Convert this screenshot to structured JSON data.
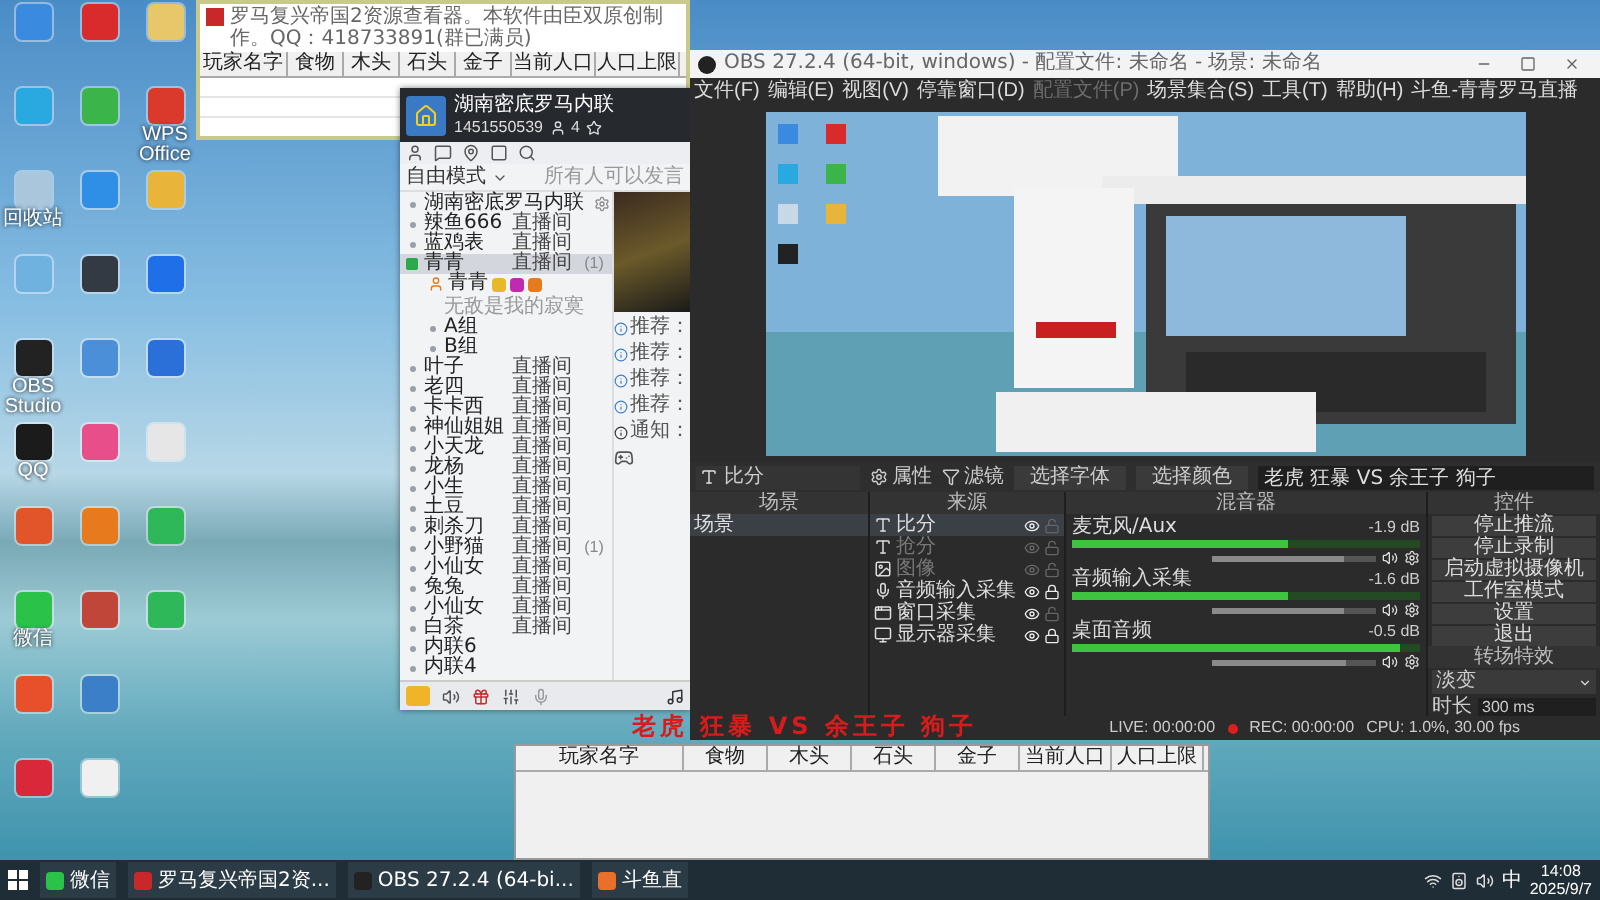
{
  "desktop_icons": [
    {
      "color": "#3a8be0"
    },
    {
      "color": "#2aa8e0"
    },
    {
      "label": "回收站",
      "color": "#a9c6dd"
    },
    {
      "color": "#6fb2e0"
    },
    {
      "label": "OBS Studio",
      "color": "#222222"
    },
    {
      "label": "QQ",
      "color": "#1b1b1b"
    },
    {
      "color": "#e2552b"
    },
    {
      "label": "微信",
      "color": "#2bc24a"
    },
    {
      "color": "#e8502b"
    },
    {
      "color": "#d8283a"
    },
    {
      "color": "#d92b2b"
    },
    {
      "color": "#3bb54a"
    },
    {
      "color": "#2f8fe6"
    },
    {
      "color": "#333a44"
    },
    {
      "color": "#4a8fd8"
    },
    {
      "color": "#e84f8a"
    },
    {
      "color": "#e87a1e"
    },
    {
      "color": "#c0463a"
    },
    {
      "color": "#3a7fc8"
    },
    {
      "color": "#f0f0f0"
    },
    {
      "color": "#e8c66a"
    },
    {
      "label": "WPS Office",
      "color": "#d93a2b"
    },
    {
      "color": "#e9b43a"
    },
    {
      "color": "#1e6fe8"
    },
    {
      "color": "#2b6fd8"
    },
    {
      "color": "#e6e6e6"
    },
    {
      "color": "#2fb85a"
    },
    {
      "color": "#2fb85a"
    }
  ],
  "resource_window": {
    "title": "罗马复兴帝国2资源查看器。本软件由臣双原创制作。QQ：418733891(群已满员)",
    "columns": [
      "玩家名字",
      "食物",
      "木头",
      "石头",
      "金子",
      "当前人口",
      "人口上限"
    ]
  },
  "yy_window": {
    "title": "湖南密底罗马内联",
    "room_id": "1451550539",
    "online_count": "4",
    "mode": "自由模式",
    "speak_rule": "所有人可以发言",
    "root_channel": "湖南密底罗马内联",
    "channels": [
      {
        "label": "辣鱼666",
        "tag": "直播间",
        "expanded": false,
        "selected": false
      },
      {
        "label": "蓝鸡表",
        "tag": "直播间",
        "expanded": false,
        "selected": false
      },
      {
        "label": "青青",
        "tag": "直播间",
        "count": "(1)",
        "expanded": true,
        "selected": true,
        "children": [
          {
            "kind": "user",
            "label": "青青",
            "signature": "无敌是我的寂寞"
          },
          {
            "kind": "channel",
            "label": "A组"
          },
          {
            "kind": "channel",
            "label": "B组"
          }
        ]
      },
      {
        "label": "叶子",
        "tag": "直播间",
        "expanded": false,
        "selected": false
      },
      {
        "label": "老四",
        "tag": "直播间",
        "expanded": false,
        "selected": false
      },
      {
        "label": "卡卡西",
        "tag": "直播间",
        "expanded": false,
        "selected": false
      },
      {
        "label": "神仙姐姐",
        "tag": "直播间",
        "expanded": false,
        "selected": false
      },
      {
        "label": "小天龙",
        "tag": "直播间",
        "expanded": false,
        "selected": false
      },
      {
        "label": "龙杨",
        "tag": "直播间",
        "expanded": false,
        "selected": false
      },
      {
        "label": "小生",
        "tag": "直播间",
        "expanded": false,
        "selected": false
      },
      {
        "label": "土豆",
        "tag": "直播间",
        "expanded": false,
        "selected": false
      },
      {
        "label": "刺杀刀",
        "tag": "直播间",
        "expanded": false,
        "selected": false
      },
      {
        "label": "小野猫",
        "tag": "直播间",
        "count": "(1)",
        "expanded": false,
        "selected": false
      },
      {
        "label": "小仙女",
        "tag": "直播间",
        "expanded": false,
        "selected": false
      },
      {
        "label": "兔兔",
        "tag": "直播间",
        "expanded": false,
        "selected": false
      },
      {
        "label": "小仙女",
        "tag": "直播间",
        "expanded": false,
        "selected": false
      },
      {
        "label": "白茶",
        "tag": "直播间",
        "expanded": false,
        "selected": false
      },
      {
        "label": "内联6",
        "expanded": false,
        "selected": false
      },
      {
        "label": "内联4",
        "expanded": false,
        "selected": false
      }
    ],
    "chat": [
      {
        "label": "推荐："
      },
      {
        "label": "推荐："
      },
      {
        "label": "推荐："
      },
      {
        "label": "推荐："
      }
    ],
    "notice": "通知："
  },
  "obs": {
    "title": "OBS 27.2.4 (64-bit, windows) - 配置文件: 未命名 - 场景: 未命名",
    "menu": [
      {
        "label": "文件(F)",
        "disabled": false
      },
      {
        "label": "编辑(E)",
        "disabled": false
      },
      {
        "label": "视图(V)",
        "disabled": false
      },
      {
        "label": "停靠窗口(D)",
        "disabled": false
      },
      {
        "label": "配置文件(P)",
        "disabled": true
      },
      {
        "label": "场景集合(S)",
        "disabled": false
      },
      {
        "label": "工具(T)",
        "disabled": false
      },
      {
        "label": "帮助(H)",
        "disabled": false
      },
      {
        "label": "斗鱼-青青罗马直播",
        "disabled": false
      }
    ],
    "source_toolbar": {
      "source": "比分",
      "properties": "属性",
      "filters": "滤镜",
      "font_button": "选择字体",
      "color_button": "选择颜色",
      "text": "老虎 狂暴 VS 余王子 狗子"
    },
    "scenes": {
      "title": "场景",
      "items": [
        {
          "name": "场景",
          "selected": true
        }
      ]
    },
    "sources": {
      "title": "来源",
      "items": [
        {
          "name": "比分",
          "kind": "text",
          "visible": true,
          "locked": false,
          "selected": true
        },
        {
          "name": "抢分",
          "kind": "text",
          "visible": false,
          "locked": false,
          "selected": false
        },
        {
          "name": "图像",
          "kind": "image",
          "visible": false,
          "locked": false,
          "selected": false
        },
        {
          "name": "音频输入采集",
          "kind": "audio",
          "visible": true,
          "locked": true,
          "selected": false
        },
        {
          "name": "窗口采集",
          "kind": "window",
          "visible": true,
          "locked": false,
          "selected": false
        },
        {
          "name": "显示器采集",
          "kind": "display",
          "visible": true,
          "locked": true,
          "selected": false
        }
      ]
    },
    "mixer": {
      "title": "混音器",
      "channels": [
        {
          "name": "麦克风/Aux",
          "reading": "-1.9 dB",
          "level": 0.62,
          "fader": {
            "level": 0.8
          }
        },
        {
          "name": "音频输入采集",
          "reading": "-1.6 dB",
          "level": 0.62,
          "fader": {
            "level": 0.8
          }
        },
        {
          "name": "桌面音频",
          "reading": "-0.5 dB",
          "level": 0.94,
          "fader": {
            "level": 0.82
          }
        }
      ]
    },
    "controls": {
      "title": "控件",
      "buttons": [
        "停止推流",
        "停止录制",
        "启动虚拟摄像机",
        "工作室模式",
        "设置",
        "退出"
      ]
    },
    "transitions": {
      "title": "转场特效",
      "type": "淡变",
      "duration_label": "时长",
      "duration": "300 ms"
    },
    "status": {
      "live": "LIVE: 00:00:00",
      "rec": "REC: 00:00:00",
      "cpu": "CPU: 1.0%, 30.00 fps"
    }
  },
  "overlay_text": "老虎 狂暴 VS 余王子 狗子",
  "table_window": {
    "columns": [
      "玩家名字",
      "食物",
      "木头",
      "石头",
      "金子",
      "当前人口",
      "人口上限"
    ]
  },
  "taskbar": {
    "items": [
      {
        "label": "微信",
        "color": "#2bc24a"
      },
      {
        "label": "罗马复兴帝国2资...",
        "color": "#c8282a"
      },
      {
        "label": "OBS 27.2.4 (64-bi...",
        "color": "#222222"
      },
      {
        "label": "斗鱼直",
        "color": "#e8702a"
      }
    ],
    "ime": "中",
    "time": "14:08",
    "date": "2025/9/7"
  }
}
